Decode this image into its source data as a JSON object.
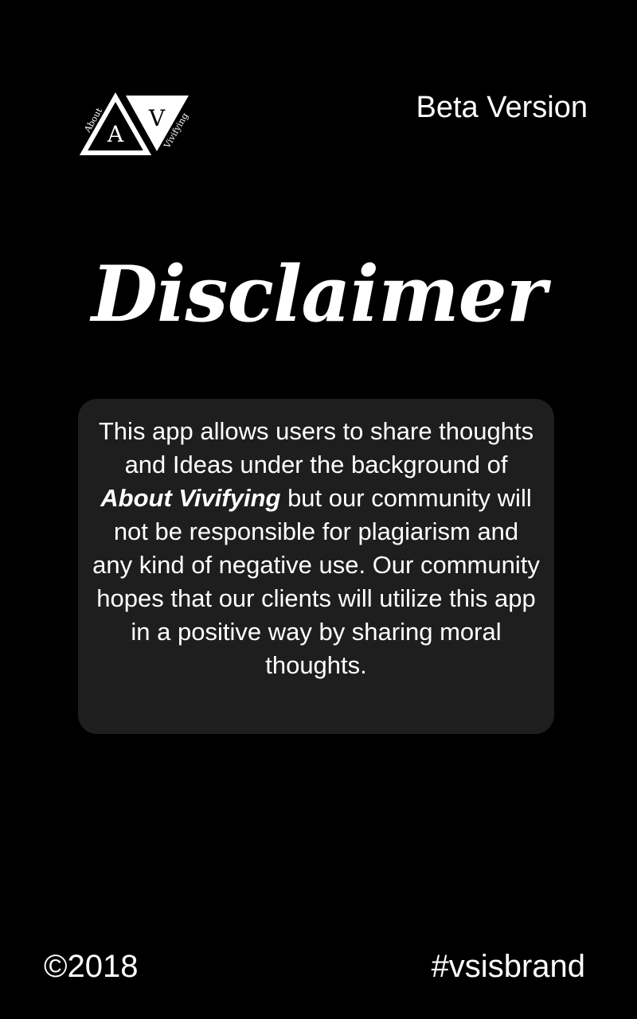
{
  "header": {
    "logo": {
      "icon": "about-vivifying-triangle-logo",
      "letter_a": "A",
      "letter_v": "V",
      "word_left": "About",
      "word_right": "Vivifying"
    },
    "version_label": "Beta Version"
  },
  "main": {
    "title": "Disclaimer",
    "disclaimer": {
      "text_before": "This app allows users to share thoughts and Ideas under the background of ",
      "brand": "About Vivifying",
      "text_after": " but our community will not be responsible for plagiarism and any kind of negative use. Our community hopes that our clients will utilize this app in a positive way by sharing moral thoughts."
    }
  },
  "footer": {
    "copyright": "©2018",
    "hashtag": "#vsisbrand"
  },
  "colors": {
    "background": "#000000",
    "card": "#1e1e1e",
    "text": "#ffffff"
  }
}
